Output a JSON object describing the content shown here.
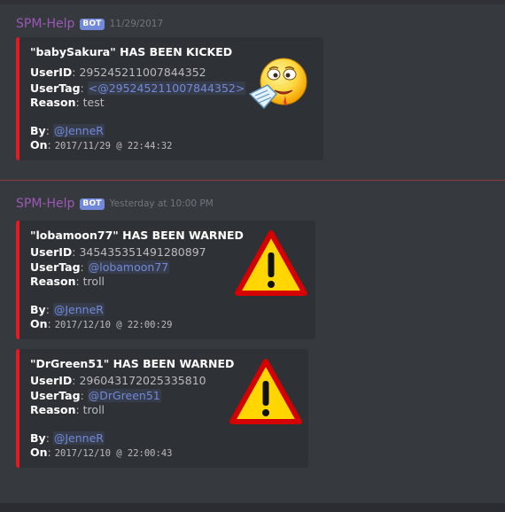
{
  "messages": [
    {
      "username": "SPM-Help",
      "badge": "BOT",
      "timestamp": "11/29/2017",
      "embeds": [
        {
          "title": "\"babySakura\" HAS BEEN KICKED",
          "user_id_label": "UserID",
          "user_id": "295245211007844352",
          "user_tag_label": "UserTag",
          "user_tag": "<@295245211007844352>",
          "reason_label": "Reason",
          "reason": "test",
          "by_label": "By",
          "by": "@JenneR",
          "on_label": "On",
          "on": "2017/11/29 @ 22:44:32",
          "thumbnail_icon": "sick-emoji-icon"
        }
      ]
    },
    {
      "username": "SPM-Help",
      "badge": "BOT",
      "timestamp": "Yesterday at 10:00 PM",
      "embeds": [
        {
          "title": "\"lobamoon77\" HAS BEEN WARNED",
          "user_id_label": "UserID",
          "user_id": "345435351491280897",
          "user_tag_label": "UserTag",
          "user_tag": "@lobamoon77",
          "reason_label": "Reason",
          "reason": "troll",
          "by_label": "By",
          "by": "@JenneR",
          "on_label": "On",
          "on": "2017/12/10 @ 22:00:29",
          "thumbnail_icon": "warning-icon"
        },
        {
          "title": "\"DrGreen51\" HAS BEEN WARNED",
          "user_id_label": "UserID",
          "user_id": "296043172025335810",
          "user_tag_label": "UserTag",
          "user_tag": "@DrGreen51",
          "reason_label": "Reason",
          "reason": "troll",
          "by_label": "By",
          "by": "@JenneR",
          "on_label": "On",
          "on": "2017/12/10 @ 22:00:43",
          "thumbnail_icon": "warning-icon"
        }
      ]
    }
  ],
  "colors": {
    "background": "#36393e",
    "embed_background": "#2e3136",
    "embed_border": "#e01b24",
    "username": "#9b59b6",
    "mention": "#7289da",
    "badge": "#7289da"
  }
}
